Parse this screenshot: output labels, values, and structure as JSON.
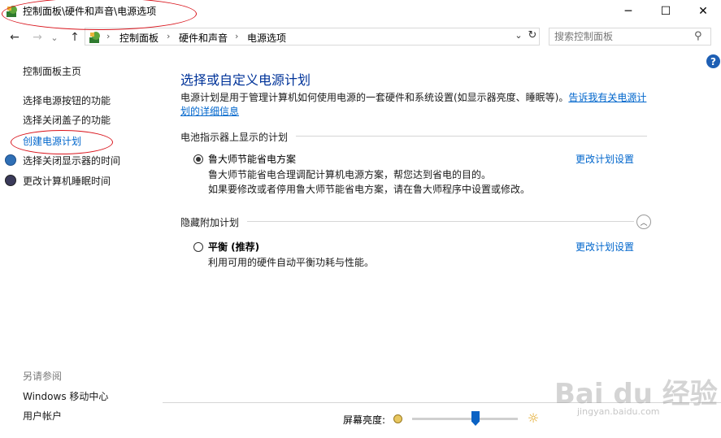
{
  "window": {
    "title": "控制面板\\硬件和声音\\电源选项",
    "minimize": "─",
    "maximize": "☐",
    "close": "✕"
  },
  "nav": {
    "back": "←",
    "forward": "→",
    "recent": "⌄",
    "up": "↑"
  },
  "address": {
    "crumbs": [
      "控制面板",
      "硬件和声音",
      "电源选项"
    ],
    "separator": "›",
    "dropdown": "⌄",
    "refresh": "↻"
  },
  "search": {
    "placeholder": "搜索控制面板",
    "icon": "⚲"
  },
  "help": {
    "label": "?"
  },
  "sidebar": {
    "home": "控制面板主页",
    "items": [
      "选择电源按钮的功能",
      "选择关闭盖子的功能",
      "创建电源计划",
      "选择关闭显示器的时间",
      "更改计算机睡眠时间"
    ],
    "see_also_title": "另请参阅",
    "see_also": [
      "Windows 移动中心",
      "用户帐户"
    ]
  },
  "main": {
    "title": "选择或自定义电源计划",
    "description": "电源计划是用于管理计算机如何使用电源的一套硬件和系统设置(如显示器亮度、睡眠等)。",
    "description_link": "告诉我有关电源计划的详细信息",
    "battery_group": "电池指示器上显示的计划",
    "plan1": {
      "name": "鲁大师节能省电方案",
      "desc1": "鲁大师节能省电合理调配计算机电源方案，帮您达到省电的目的。",
      "desc2": "如果要修改或者停用鲁大师节能省电方案，请在鲁大师程序中设置或修改。",
      "link": "更改计划设置"
    },
    "hidden_group": "隐藏附加计划",
    "collapse": "︿",
    "plan2": {
      "name": "平衡 (推荐)",
      "desc": "利用可用的硬件自动平衡功耗与性能。",
      "link": "更改计划设置"
    }
  },
  "brightness": {
    "label": "屏幕亮度:",
    "level": 0.6,
    "bright_icon": "☼"
  },
  "watermark": {
    "text": "Bai du 经验",
    "url": "jingyan.baidu.com"
  },
  "colors": {
    "link": "#0066cc",
    "title": "#003399",
    "annotation": "#d9141c"
  }
}
